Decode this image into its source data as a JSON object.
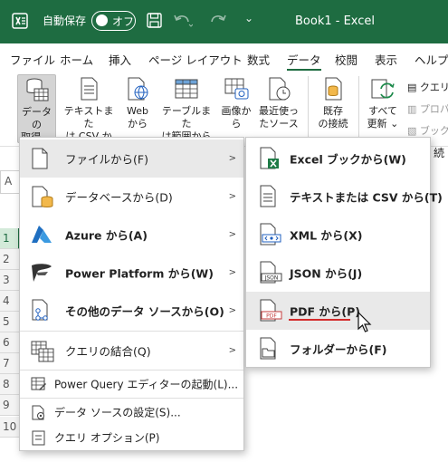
{
  "titlebar": {
    "autosave_label": "自動保存",
    "toggle_state": "オフ",
    "more_label": "⌄",
    "doc_title": "Book1  -  Excel",
    "brand_color": "#1e6c41"
  },
  "tabs": [
    "ファイル",
    "ホーム",
    "挿入",
    "ページ レイアウト",
    "数式",
    "データ",
    "校閲",
    "表示",
    "ヘルプ"
  ],
  "active_tab": "データ",
  "ribbon": {
    "get_data": [
      "データの",
      "取得 ⌄"
    ],
    "from_text_csv": [
      "テキストまた",
      "は CSV から"
    ],
    "from_web": [
      "Web",
      "から"
    ],
    "from_table": [
      "テーブルまた",
      "は範囲から"
    ],
    "from_picture": [
      "画像から",
      "⌄"
    ],
    "recent_sources": [
      "最近使っ",
      "たソース"
    ],
    "existing_connections": [
      "既存",
      "の接続"
    ],
    "refresh_all": [
      "すべて",
      "更新 ⌄"
    ],
    "queries": "クエリ",
    "properties": "プロパ",
    "links": "ブック"
  },
  "grid": {
    "namebox": "A",
    "rows": [
      "1",
      "2",
      "3",
      "4",
      "5",
      "6",
      "7",
      "8",
      "9",
      "10"
    ],
    "right_fragment": "続"
  },
  "main_menu": {
    "items": [
      {
        "label": "ファイルから(F)",
        "icon": "file-icon",
        "submenu": true
      },
      {
        "label": "データベースから(D)",
        "icon": "database-icon",
        "submenu": true
      },
      {
        "label": "Azure から(A)",
        "icon": "azure-icon",
        "submenu": true
      },
      {
        "label": "Power Platform から(W)",
        "icon": "power-platform-icon",
        "submenu": true
      },
      {
        "label": "その他のデータ ソースから(O)",
        "icon": "other-sources-icon",
        "submenu": true
      },
      {
        "label": "クエリの結合(Q)",
        "icon": "combine-queries-icon",
        "submenu": true
      },
      {
        "label": "Power Query エディターの起動(L)...",
        "icon": "pq-editor-icon",
        "submenu": false
      },
      {
        "label": "データ ソースの設定(S)...",
        "icon": "data-source-settings-icon",
        "submenu": false
      },
      {
        "label": "クエリ オプション(P)",
        "icon": "query-options-icon",
        "submenu": false
      }
    ]
  },
  "sub_menu": {
    "items": [
      {
        "label": "Excel ブックから(W)",
        "icon": "excel-workbook-icon"
      },
      {
        "label": "テキストまたは CSV から(T)",
        "icon": "text-csv-icon"
      },
      {
        "label": "XML から(X)",
        "icon": "xml-icon"
      },
      {
        "label": "JSON から(J)",
        "icon": "json-icon"
      },
      {
        "label": "PDF から(P)",
        "icon": "pdf-icon"
      },
      {
        "label": "フォルダーから(F)",
        "icon": "folder-icon"
      }
    ],
    "highlighted": "PDF から(P)",
    "highlight_color": "#d42b2b"
  }
}
